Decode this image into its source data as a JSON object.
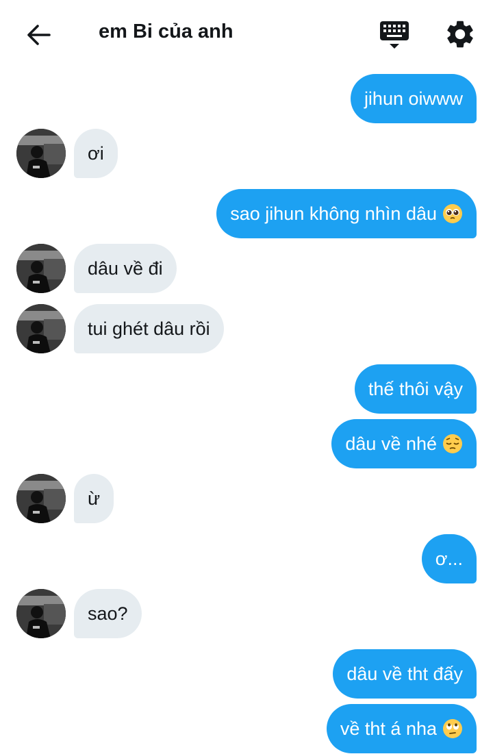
{
  "header": {
    "title": "em Bi của anh"
  },
  "messages": [
    {
      "side": "sent",
      "text": "jihun oiwww"
    },
    {
      "side": "recv",
      "text": "ơi"
    },
    {
      "side": "sent",
      "text": "sao jihun không nhìn dâu",
      "emoji": "pleading-face-emoji"
    },
    {
      "side": "recv",
      "text": "dâu về đi"
    },
    {
      "side": "recv",
      "text": "tui ghét dâu rồi"
    },
    {
      "side": "sent",
      "text": "thế thôi vậy"
    },
    {
      "side": "sent",
      "text": "dâu về nhé",
      "emoji": "pensive-face-emoji"
    },
    {
      "side": "recv",
      "text": "ừ"
    },
    {
      "side": "sent",
      "text": "ơ..."
    },
    {
      "side": "recv",
      "text": "sao?"
    },
    {
      "side": "sent",
      "text": "dâu về tht đấy"
    },
    {
      "side": "sent",
      "text": "về tht á nha",
      "emoji": "eye-roll-face-emoji"
    }
  ],
  "colors": {
    "sent_bubble": "#1da1f2",
    "recv_bubble": "#e6ecf0",
    "text": "#14171a"
  },
  "icons": [
    "back-arrow-icon",
    "keyboard-icon",
    "gear-icon"
  ]
}
